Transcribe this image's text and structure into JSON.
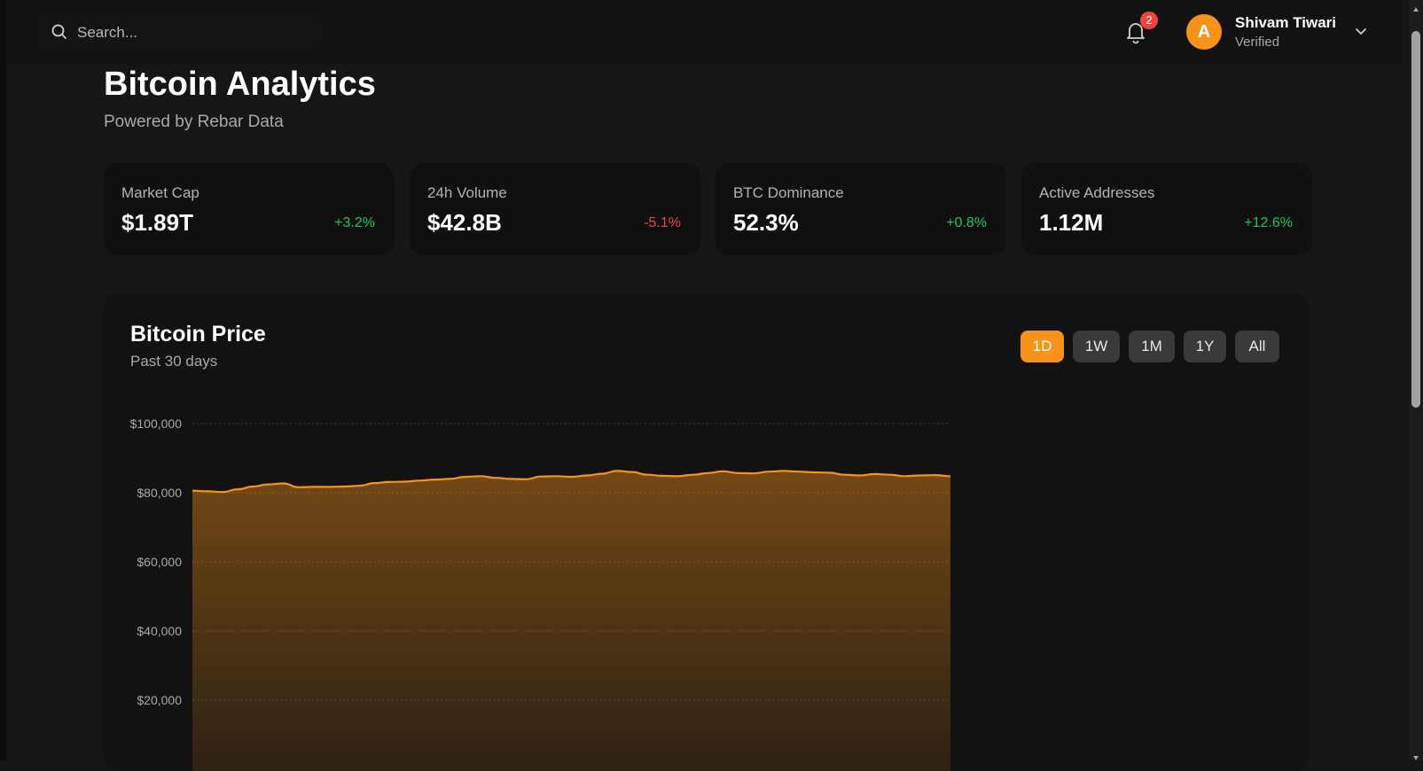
{
  "search": {
    "placeholder": "Search..."
  },
  "notifications": {
    "count": "2"
  },
  "user": {
    "initial": "A",
    "name": "Shivam Tiwari",
    "status": "Verified"
  },
  "header": {
    "title": "Bitcoin Analytics",
    "subtitle": "Powered by Rebar Data"
  },
  "stats": [
    {
      "label": "Market Cap",
      "value": "$1.89T",
      "change": "+3.2%",
      "trend": "up"
    },
    {
      "label": "24h Volume",
      "value": "$42.8B",
      "change": "-5.1%",
      "trend": "down"
    },
    {
      "label": "BTC Dominance",
      "value": "52.3%",
      "change": "+0.8%",
      "trend": "up"
    },
    {
      "label": "Active Addresses",
      "value": "1.12M",
      "change": "+12.6%",
      "trend": "up"
    }
  ],
  "price_panel": {
    "title": "Bitcoin Price",
    "subtitle": "Past 30 days",
    "ranges": [
      "1D",
      "1W",
      "1M",
      "1Y",
      "All"
    ],
    "active_range": "1D"
  },
  "colors": {
    "accent": "#f7931a",
    "positive": "#22c55e",
    "negative": "#ef4444"
  },
  "chart_data": {
    "type": "area",
    "ylim": [
      0,
      100000
    ],
    "y_ticks": [
      "$100,000",
      "$80,000",
      "$60,000",
      "$40,000",
      "$20,000"
    ],
    "y_tick_values": [
      100000,
      80000,
      60000,
      40000,
      20000
    ],
    "grid": true,
    "series": [
      {
        "values": [
          80600,
          80400,
          80200,
          81000,
          81800,
          82400,
          82700,
          81600,
          81700,
          81700,
          81800,
          82000,
          82800,
          83100,
          83200,
          83500,
          83800,
          84000,
          84600,
          84800,
          84300,
          84000,
          83900,
          84700,
          84800,
          84600,
          85000,
          85500,
          86300,
          86000,
          85200,
          84900,
          84800,
          85200,
          85700,
          86200,
          85700,
          85600,
          86100,
          86300,
          86100,
          85900,
          85800,
          85200,
          85000,
          85400,
          85200,
          84800,
          85000,
          85100,
          84800
        ]
      }
    ]
  }
}
